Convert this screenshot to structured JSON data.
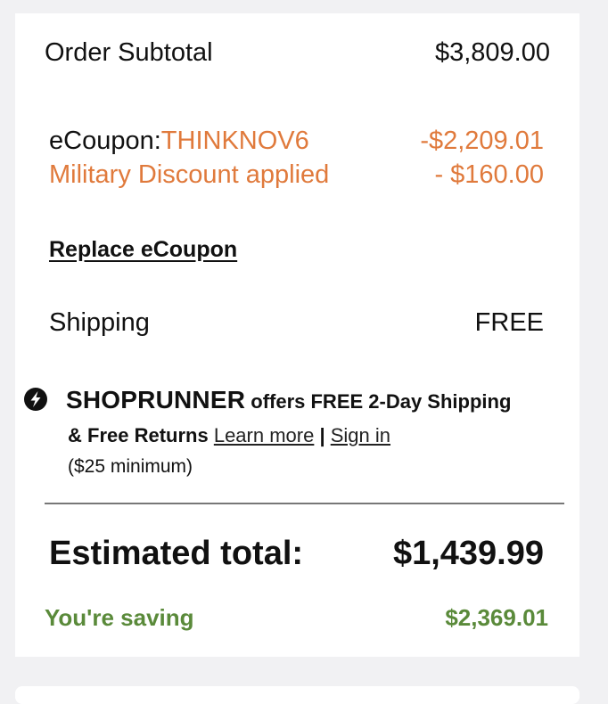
{
  "summary": {
    "subtotal_label": "Order Subtotal",
    "subtotal_value": "$3,809.00",
    "coupon_prefix": "eCoupon:",
    "coupon_code": "THINKNOV6",
    "coupon_discount": "-$2,209.01",
    "military_label": "Military Discount applied",
    "military_discount": "- $160.00",
    "replace_coupon": "Replace eCoupon",
    "shipping_label": "Shipping",
    "shipping_value": "FREE"
  },
  "shoprunner": {
    "icon": "shoprunner-icon",
    "brand": "SHOPRUNNER",
    "offer_text": " offers FREE 2-Day Shipping",
    "returns_text": "& Free Returns ",
    "learn_more": "Learn more",
    "separator": " | ",
    "sign_in": "Sign in",
    "minimum": "($25 minimum)"
  },
  "totals": {
    "estimated_label": "Estimated total:",
    "estimated_value": "$1,439.99",
    "saving_label": "You're saving",
    "saving_value": "$2,369.01"
  },
  "colors": {
    "accent_orange": "#e07a3c",
    "saving_green": "#5a8a3a"
  }
}
